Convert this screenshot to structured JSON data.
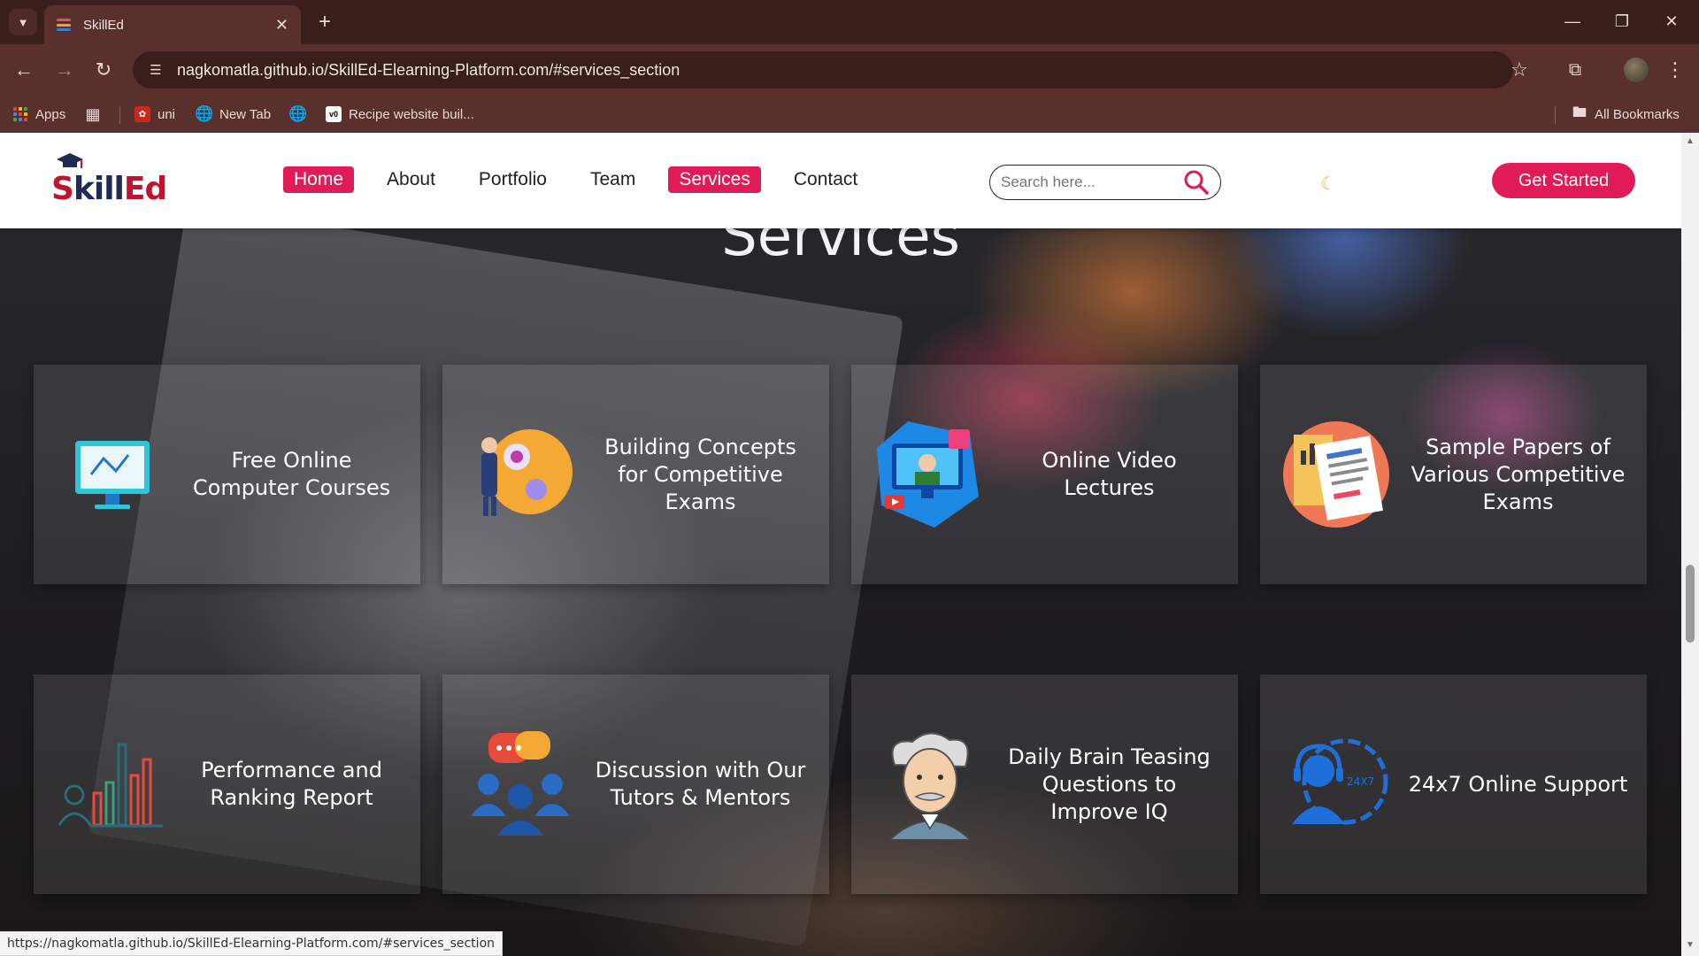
{
  "browser": {
    "tab_title": "SkillEd",
    "url": "nagkomatla.github.io/SkillEd-Elearning-Platform.com/#services_section",
    "bookmarks": [
      {
        "label": "Apps",
        "icon": "apps-icon"
      },
      {
        "label": "",
        "icon": "grid-icon"
      },
      {
        "label": "uni",
        "icon": "uni-favicon"
      },
      {
        "label": "New Tab",
        "icon": "globe-icon"
      },
      {
        "label": "",
        "icon": "globe-icon"
      },
      {
        "label": "Recipe website buil...",
        "icon": "v0-icon"
      }
    ],
    "all_bookmarks": "All Bookmarks",
    "status_url": "https://nagkomatla.github.io/SkillEd-Elearning-Platform.com/#services_section"
  },
  "site": {
    "logo": {
      "s": "S",
      "k": "kill",
      "ed": "Ed"
    },
    "nav": [
      {
        "label": "Home",
        "active": true
      },
      {
        "label": "About",
        "active": false
      },
      {
        "label": "Portfolio",
        "active": false
      },
      {
        "label": "Team",
        "active": false
      },
      {
        "label": "Services",
        "active": true
      },
      {
        "label": "Contact",
        "active": false
      }
    ],
    "search_placeholder": "Search here...",
    "cta_label": "Get Started",
    "accent": "#e11b58"
  },
  "services": {
    "title": "Services",
    "items": [
      {
        "label": "Free Online Computer Courses",
        "icon": "computer-monitor-icon"
      },
      {
        "label": "Building Concepts for Competitive Exams",
        "icon": "student-ideas-icon"
      },
      {
        "label": "Online Video Lectures",
        "icon": "video-lecture-icon"
      },
      {
        "label": "Sample Papers of Various Competitive Exams",
        "icon": "sample-papers-icon"
      },
      {
        "label": "Performance and Ranking Report",
        "icon": "bar-chart-icon"
      },
      {
        "label": "Discussion with Our Tutors & Mentors",
        "icon": "group-discussion-icon"
      },
      {
        "label": "Daily Brain Teasing Questions to Improve IQ",
        "icon": "einstein-icon"
      },
      {
        "label": "24x7 Online Support",
        "icon": "support-headset-icon"
      }
    ]
  }
}
